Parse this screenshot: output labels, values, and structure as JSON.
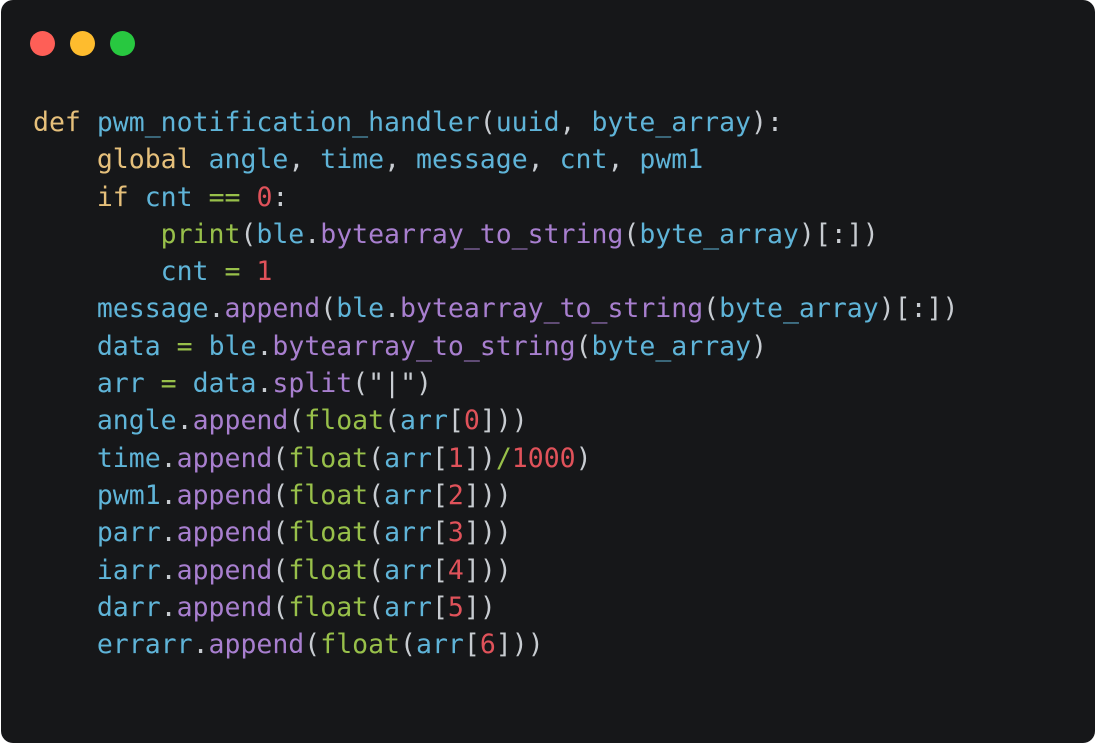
{
  "window": {
    "controls": [
      {
        "name": "close",
        "color": "#fe5f57"
      },
      {
        "name": "minimize",
        "color": "#febc2e"
      },
      {
        "name": "zoom",
        "color": "#28c840"
      }
    ]
  },
  "code": {
    "lines": [
      [
        [
          "kw",
          "def"
        ],
        [
          "p",
          " "
        ],
        [
          "fn",
          "pwm_notification_handler"
        ],
        [
          "p",
          "("
        ],
        [
          "var",
          "uuid"
        ],
        [
          "p",
          ", "
        ],
        [
          "var",
          "byte_array"
        ],
        [
          "p",
          "):"
        ]
      ],
      [
        [
          "p",
          "    "
        ],
        [
          "kw",
          "global"
        ],
        [
          "p",
          " "
        ],
        [
          "var",
          "angle"
        ],
        [
          "p",
          ", "
        ],
        [
          "var",
          "time"
        ],
        [
          "p",
          ", "
        ],
        [
          "var",
          "message"
        ],
        [
          "p",
          ", "
        ],
        [
          "var",
          "cnt"
        ],
        [
          "p",
          ", "
        ],
        [
          "var",
          "pwm1"
        ]
      ],
      [
        [
          "p",
          "    "
        ],
        [
          "kw",
          "if"
        ],
        [
          "p",
          " "
        ],
        [
          "var",
          "cnt"
        ],
        [
          "p",
          " "
        ],
        [
          "op",
          "=="
        ],
        [
          "p",
          " "
        ],
        [
          "num",
          "0"
        ],
        [
          "p",
          ":"
        ]
      ],
      [
        [
          "p",
          "        "
        ],
        [
          "bi",
          "print"
        ],
        [
          "p",
          "("
        ],
        [
          "var",
          "ble"
        ],
        [
          "p",
          "."
        ],
        [
          "meth",
          "bytearray_to_string"
        ],
        [
          "p",
          "("
        ],
        [
          "var",
          "byte_array"
        ],
        [
          "p",
          ")[:])"
        ]
      ],
      [
        [
          "p",
          "        "
        ],
        [
          "var",
          "cnt"
        ],
        [
          "p",
          " "
        ],
        [
          "op",
          "="
        ],
        [
          "p",
          " "
        ],
        [
          "num",
          "1"
        ]
      ],
      [
        [
          "p",
          "    "
        ],
        [
          "var",
          "message"
        ],
        [
          "p",
          "."
        ],
        [
          "meth",
          "append"
        ],
        [
          "p",
          "("
        ],
        [
          "var",
          "ble"
        ],
        [
          "p",
          "."
        ],
        [
          "meth",
          "bytearray_to_string"
        ],
        [
          "p",
          "("
        ],
        [
          "var",
          "byte_array"
        ],
        [
          "p",
          ")[:])"
        ]
      ],
      [
        [
          "p",
          "    "
        ],
        [
          "var",
          "data"
        ],
        [
          "p",
          " "
        ],
        [
          "op",
          "="
        ],
        [
          "p",
          " "
        ],
        [
          "var",
          "ble"
        ],
        [
          "p",
          "."
        ],
        [
          "meth",
          "bytearray_to_string"
        ],
        [
          "p",
          "("
        ],
        [
          "var",
          "byte_array"
        ],
        [
          "p",
          ")"
        ]
      ],
      [
        [
          "p",
          "    "
        ],
        [
          "var",
          "arr"
        ],
        [
          "p",
          " "
        ],
        [
          "op",
          "="
        ],
        [
          "p",
          " "
        ],
        [
          "var",
          "data"
        ],
        [
          "p",
          "."
        ],
        [
          "meth",
          "split"
        ],
        [
          "p",
          "("
        ],
        [
          "str",
          "\"|\""
        ],
        [
          "p",
          ")"
        ]
      ],
      [
        [
          "p",
          "    "
        ],
        [
          "var",
          "angle"
        ],
        [
          "p",
          "."
        ],
        [
          "meth",
          "append"
        ],
        [
          "p",
          "("
        ],
        [
          "bi",
          "float"
        ],
        [
          "p",
          "("
        ],
        [
          "var",
          "arr"
        ],
        [
          "p",
          "["
        ],
        [
          "num",
          "0"
        ],
        [
          "p",
          "]))"
        ]
      ],
      [
        [
          "p",
          "    "
        ],
        [
          "var",
          "time"
        ],
        [
          "p",
          "."
        ],
        [
          "meth",
          "append"
        ],
        [
          "p",
          "("
        ],
        [
          "bi",
          "float"
        ],
        [
          "p",
          "("
        ],
        [
          "var",
          "arr"
        ],
        [
          "p",
          "["
        ],
        [
          "num",
          "1"
        ],
        [
          "p",
          "])"
        ],
        [
          "op",
          "/"
        ],
        [
          "num",
          "1000"
        ],
        [
          "p",
          ")"
        ]
      ],
      [
        [
          "p",
          "    "
        ],
        [
          "var",
          "pwm1"
        ],
        [
          "p",
          "."
        ],
        [
          "meth",
          "append"
        ],
        [
          "p",
          "("
        ],
        [
          "bi",
          "float"
        ],
        [
          "p",
          "("
        ],
        [
          "var",
          "arr"
        ],
        [
          "p",
          "["
        ],
        [
          "num",
          "2"
        ],
        [
          "p",
          "]))"
        ]
      ],
      [
        [
          "p",
          "    "
        ],
        [
          "var",
          "parr"
        ],
        [
          "p",
          "."
        ],
        [
          "meth",
          "append"
        ],
        [
          "p",
          "("
        ],
        [
          "bi",
          "float"
        ],
        [
          "p",
          "("
        ],
        [
          "var",
          "arr"
        ],
        [
          "p",
          "["
        ],
        [
          "num",
          "3"
        ],
        [
          "p",
          "]))"
        ]
      ],
      [
        [
          "p",
          "    "
        ],
        [
          "var",
          "iarr"
        ],
        [
          "p",
          "."
        ],
        [
          "meth",
          "append"
        ],
        [
          "p",
          "("
        ],
        [
          "bi",
          "float"
        ],
        [
          "p",
          "("
        ],
        [
          "var",
          "arr"
        ],
        [
          "p",
          "["
        ],
        [
          "num",
          "4"
        ],
        [
          "p",
          "]))"
        ]
      ],
      [
        [
          "p",
          "    "
        ],
        [
          "var",
          "darr"
        ],
        [
          "p",
          "."
        ],
        [
          "meth",
          "append"
        ],
        [
          "p",
          "("
        ],
        [
          "bi",
          "float"
        ],
        [
          "p",
          "("
        ],
        [
          "var",
          "arr"
        ],
        [
          "p",
          "["
        ],
        [
          "num",
          "5"
        ],
        [
          "p",
          "])"
        ]
      ],
      [
        [
          "p",
          "    "
        ],
        [
          "var",
          "errarr"
        ],
        [
          "p",
          "."
        ],
        [
          "meth",
          "append"
        ],
        [
          "p",
          "("
        ],
        [
          "bi",
          "float"
        ],
        [
          "p",
          "("
        ],
        [
          "var",
          "arr"
        ],
        [
          "p",
          "["
        ],
        [
          "num",
          "6"
        ],
        [
          "p",
          "]))"
        ]
      ]
    ]
  }
}
